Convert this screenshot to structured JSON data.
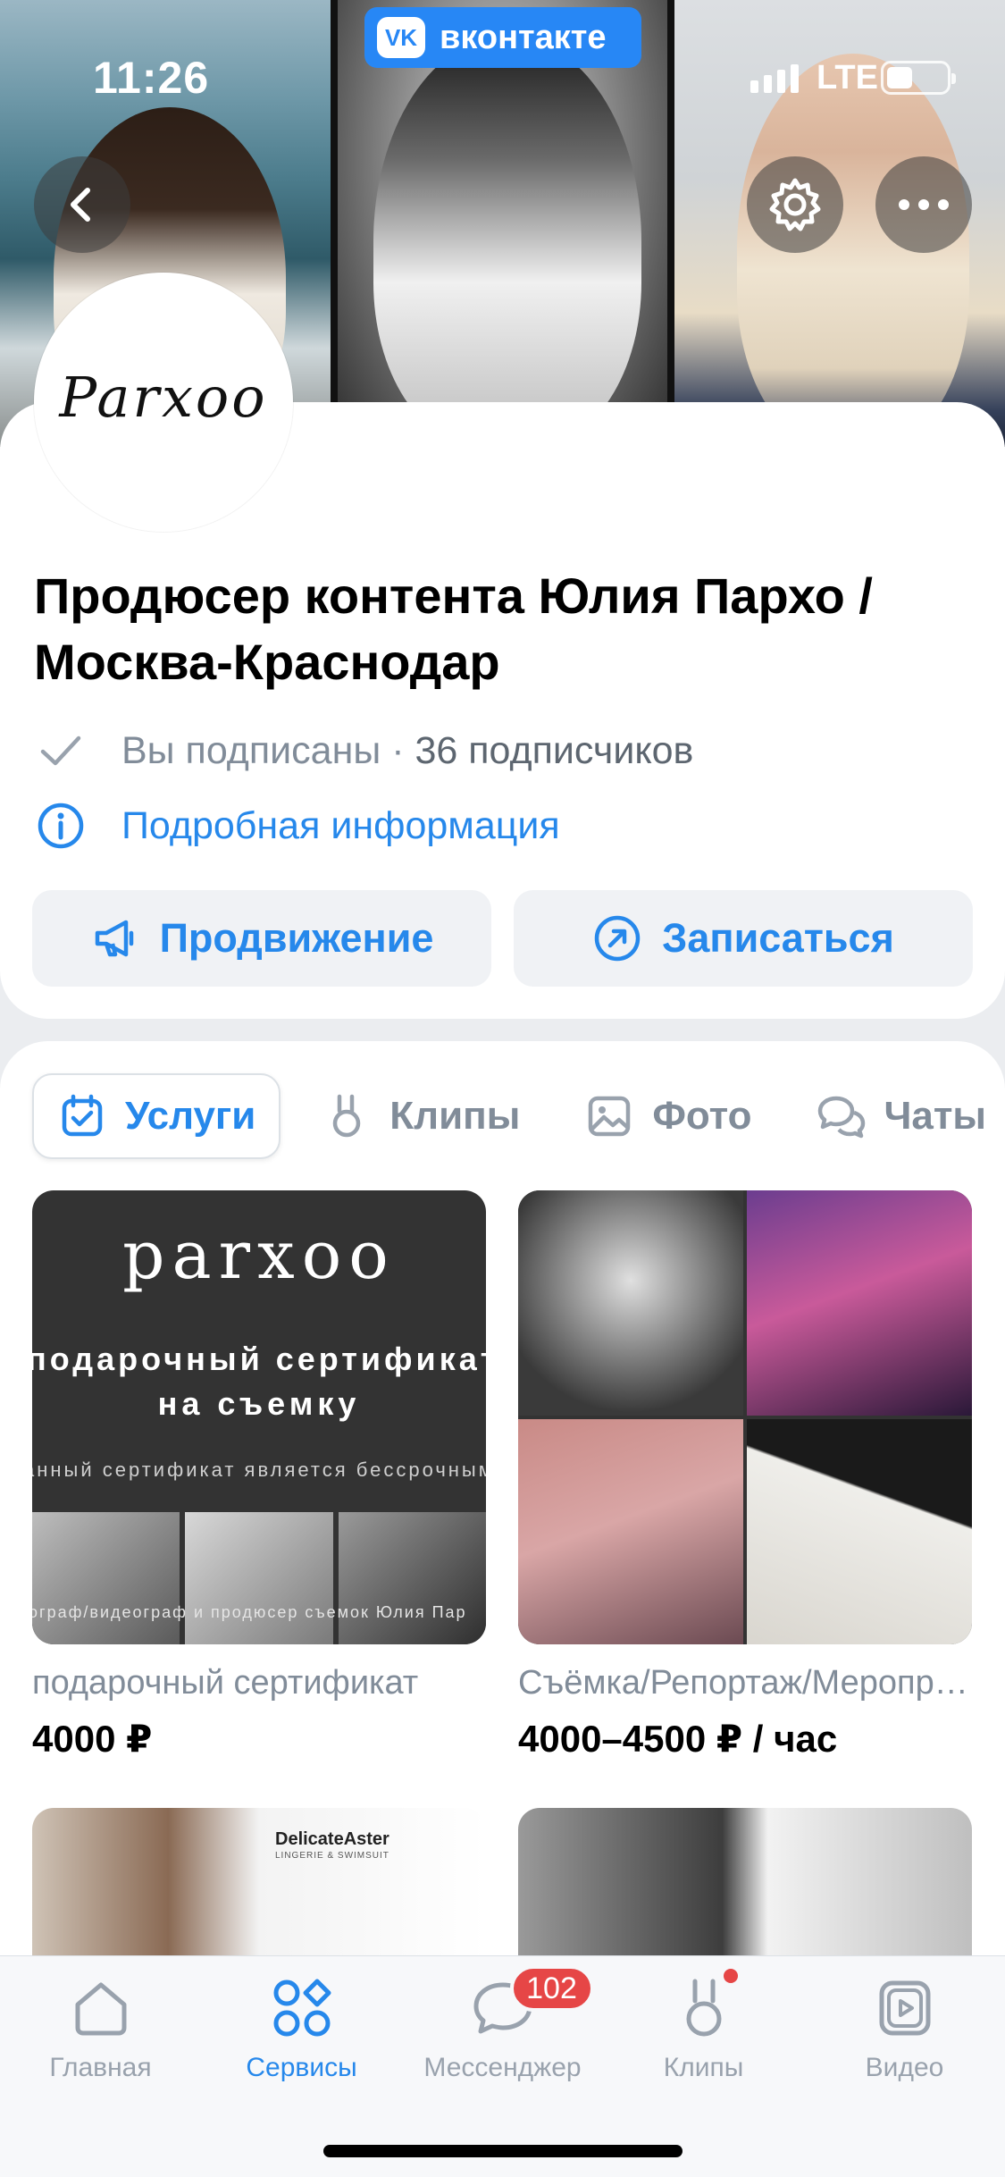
{
  "status_bar": {
    "time": "11:26",
    "network": "LTE",
    "app_badge": "вконтакте",
    "vk_logo": "VK"
  },
  "cover": {
    "back_icon": "chevron-left-icon",
    "settings_icon": "gear-icon",
    "more_icon": "more-horizontal-icon"
  },
  "avatar": {
    "text": "Parxoo"
  },
  "group": {
    "title": "Продюсер контента Юлия Пархо / Москва-Краснодар",
    "subscribed_text": "Вы подписаны",
    "separator": " · ",
    "followers": "36 подписчиков",
    "details_link": "Подробная информация"
  },
  "actions": {
    "promo": "Продвижение",
    "signup": "Записаться"
  },
  "tabs": [
    {
      "label": "Услуги",
      "icon": "calendar-check-icon",
      "active": true
    },
    {
      "label": "Клипы",
      "icon": "clips-icon",
      "active": false
    },
    {
      "label": "Фото",
      "icon": "photo-icon",
      "active": false
    },
    {
      "label": "Чаты",
      "icon": "chats-icon",
      "active": false
    }
  ],
  "products": [
    {
      "title": "подарочный сертификат",
      "price": "4000 ₽",
      "image_text": {
        "brand": "parxoo",
        "line1": "подарочный сертификат",
        "line2": "на съемку",
        "line3": "анный сертификат является бессрочным",
        "line4": "ограф/видеограф и продюсер съемок Юлия Пар"
      }
    },
    {
      "title": "Съёмка/Репортаж/Мероприятия",
      "price": "4000–4500 ₽ / час"
    },
    {
      "title": "",
      "price": "",
      "image_text": {
        "brand": "DelicateAster",
        "sub": "LINGERIE & SWIMSUIT"
      }
    },
    {
      "title": "",
      "price": ""
    }
  ],
  "tabbar": [
    {
      "label": "Главная",
      "icon": "home-icon",
      "active": false
    },
    {
      "label": "Сервисы",
      "icon": "services-icon",
      "active": true
    },
    {
      "label": "Мессенджер",
      "icon": "messenger-icon",
      "active": false,
      "badge": "102"
    },
    {
      "label": "Клипы",
      "icon": "clips-icon",
      "active": false,
      "dot": true
    },
    {
      "label": "Видео",
      "icon": "video-icon",
      "active": false
    }
  ],
  "colors": {
    "accent": "#2688eb",
    "vk_blue": "#2787f5",
    "badge_red": "#e64646",
    "secondary_text": "#818c99"
  }
}
